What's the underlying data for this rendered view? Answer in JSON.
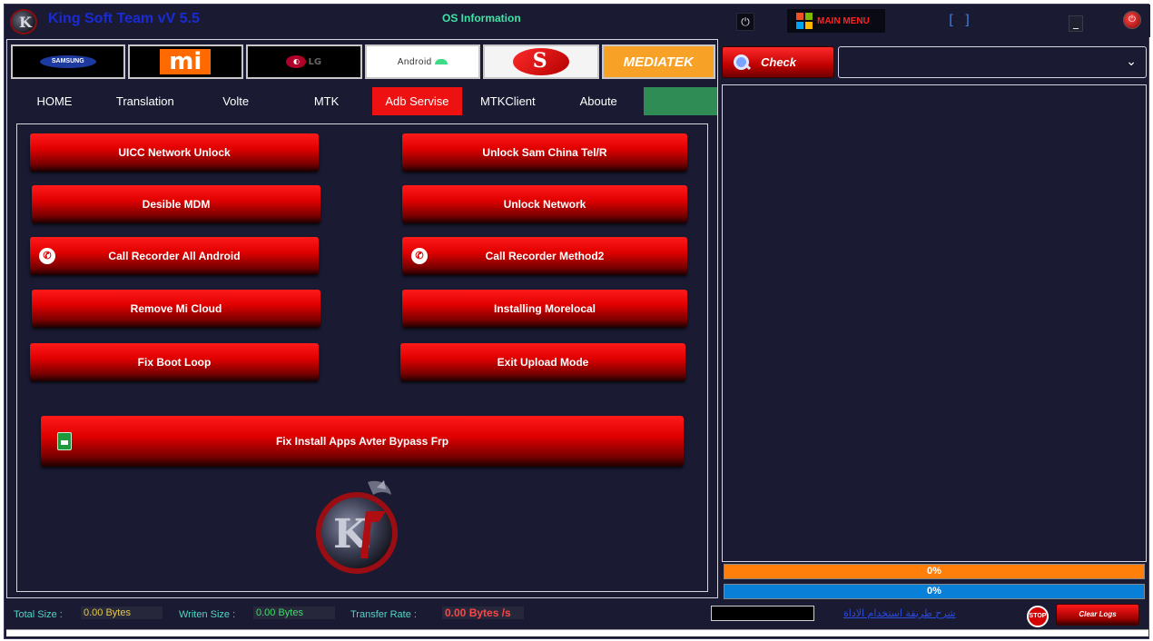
{
  "titlebar": {
    "title": "King Soft Team vV 5.5",
    "os_info": "OS Information",
    "main_menu_label": "MAIN MENU",
    "brackets": "[ ]",
    "minimize": "_",
    "power": "⏻"
  },
  "brands": {
    "samsung": "SAMSUNG",
    "mi": "mi",
    "lg": "LG",
    "lg_circle": "◐",
    "android": "Android",
    "mediatek": "MEDIATEK"
  },
  "nav": {
    "tabs": [
      "HOME",
      "Translation",
      "Volte",
      "MTK",
      "Adb Servise",
      "MTKClient",
      "Aboute"
    ],
    "active_index": 4
  },
  "buttons": {
    "uicc": "UICC Network Unlock",
    "unlock_sam_china": "Unlock Sam China Tel/R",
    "desible_mdm": "Desible MDM",
    "unlock_network": "Unlock Network",
    "call_recorder_all": "Call Recorder All Android",
    "call_recorder_m2": "Call Recorder Method2",
    "remove_mi_cloud": "Remove Mi Cloud",
    "installing_morelocal": "Installing Morelocal",
    "fix_boot_loop": "Fix Boot Loop",
    "exit_upload_mode": "Exit Upload Mode",
    "fix_install_apps": "Fix Install Apps Avter Bypass Frp",
    "phone_glyph": "✆"
  },
  "right": {
    "check_label": "Check",
    "select_value": "",
    "chevron": "⌄",
    "progress1": "0%",
    "progress2": "0%"
  },
  "status": {
    "total_size_label": "Total Size :",
    "total_size_value": "0.00 Bytes",
    "writen_size_label": "Writen Size :",
    "writen_size_value": "0.00 Bytes",
    "transfer_rate_label": "Transfer Rate :",
    "transfer_rate_value": "0.00 Bytes /s",
    "help_link": "شرح طريقة استخدام الاداة",
    "stop_label": "STOP",
    "clear_logs_label": "Clear Logs"
  },
  "colors": {
    "accent_red": "#ee1111",
    "background": "#1a1b33",
    "progress_orange": "#ff7f0a",
    "progress_blue": "#0a7fd8",
    "total_value_color": "#e6c84a",
    "writen_value_color": "#3fdc6a",
    "transfer_value_color": "#ff4545"
  },
  "icons": [
    "app-logo-icon",
    "power-icon",
    "windows-icon",
    "minimize-icon",
    "close-icon",
    "search-icon",
    "phone-icon",
    "apk-icon",
    "chevron-down-icon",
    "stop-icon"
  ]
}
